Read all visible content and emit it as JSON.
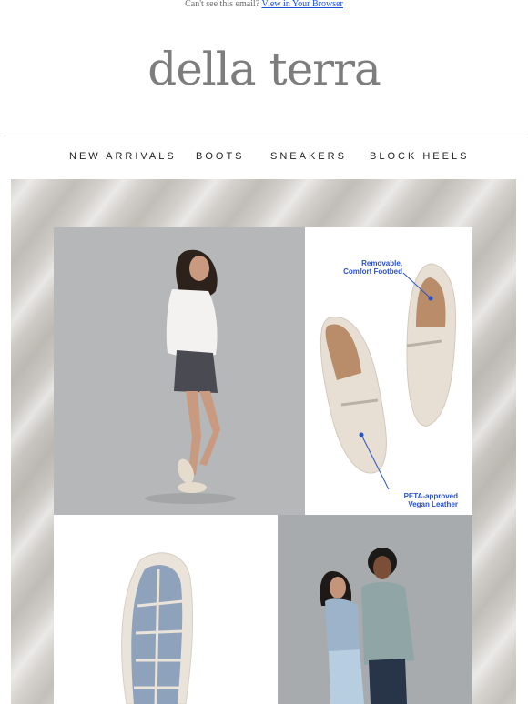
{
  "preheader": {
    "text": "Can't see this email?",
    "link": "View in Your Browser"
  },
  "brand": {
    "logo_text": "della terra",
    "logo_color": "#7d7d7d"
  },
  "nav": {
    "items": [
      {
        "label": "NEW ARRIVALS"
      },
      {
        "label": "BOOTS"
      },
      {
        "label": "SNEAKERS"
      },
      {
        "label": "BLOCK HEELS"
      }
    ]
  },
  "hero": {
    "callouts": {
      "footbed_line1": "Removable,",
      "footbed_line2": "Comfort Footbed",
      "leather_line1": "PETA-approved",
      "leather_line2": "Vegan Leather"
    },
    "accent_color": "#2b52c7"
  }
}
